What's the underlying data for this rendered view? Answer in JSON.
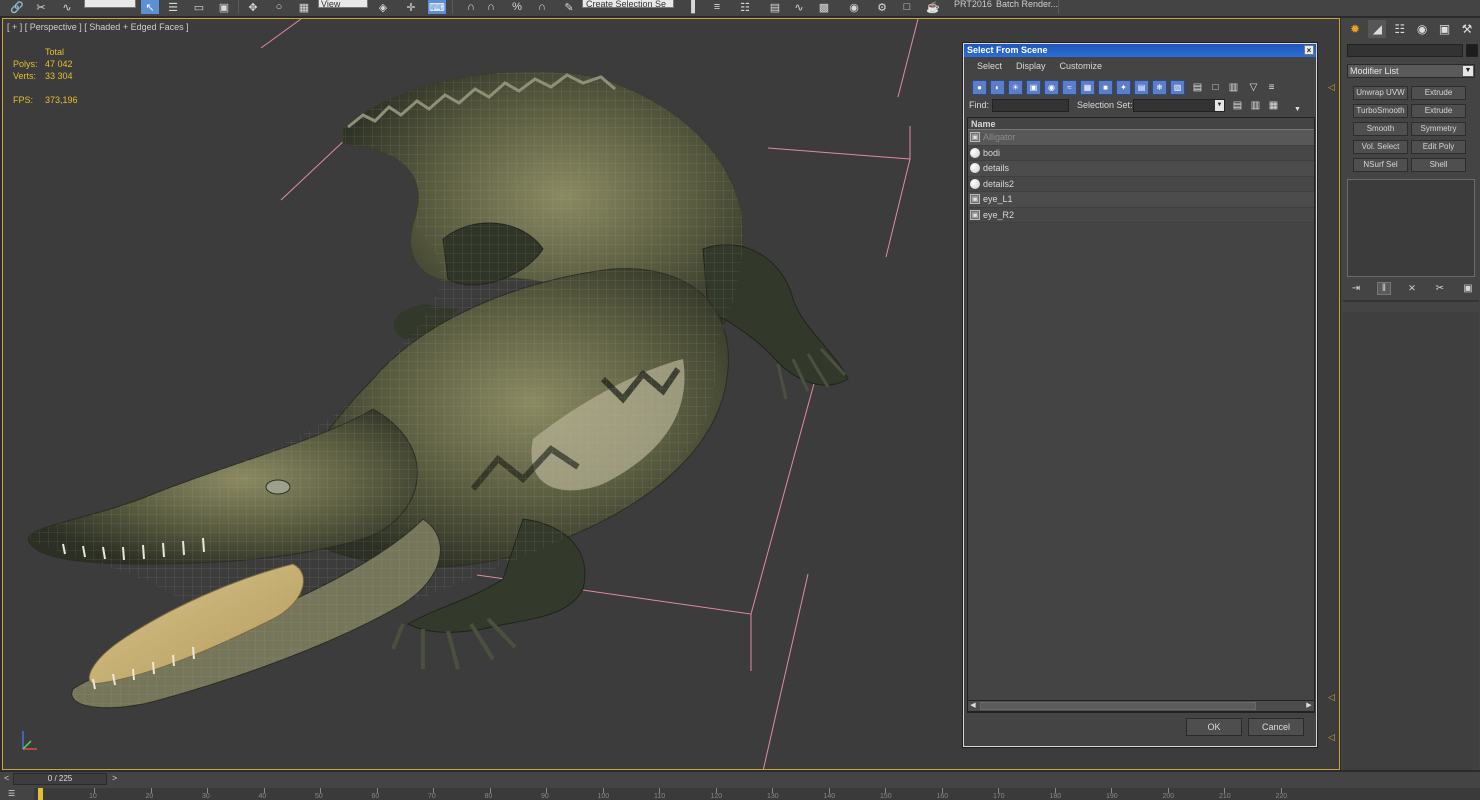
{
  "toolbar": {
    "view_dropdown": "View",
    "selection_set": "Create Selection Se",
    "prt_label": "PRT2016",
    "batch_render": "Batch Render..."
  },
  "viewport": {
    "label": "[ + ] [ Perspective ] [ Shaded + Edged Faces ]",
    "stats": {
      "total_label": "Total",
      "polys_label": "Polys:",
      "polys_value": "47 042",
      "verts_label": "Verts:",
      "verts_value": "33 304",
      "fps_label": "FPS:",
      "fps_value": "373,196"
    }
  },
  "dialog": {
    "title": "Select From Scene",
    "close": "×",
    "menu": [
      "Select",
      "Display",
      "Customize"
    ],
    "find_label": "Find:",
    "find_value": "",
    "selection_set_label": "Selection Set:",
    "column_header": "Name",
    "rows": [
      {
        "name": "Alligator",
        "icon": "group-icon",
        "selected": true
      },
      {
        "name": "bodi",
        "icon": "sphere-icon",
        "selected": false
      },
      {
        "name": "details",
        "icon": "sphere-icon",
        "selected": false
      },
      {
        "name": "details2",
        "icon": "sphere-icon",
        "selected": false
      },
      {
        "name": "eye_L1",
        "icon": "group-icon",
        "selected": false
      },
      {
        "name": "eye_R2",
        "icon": "group-icon",
        "selected": false
      }
    ],
    "ok": "OK",
    "cancel": "Cancel"
  },
  "command_panel": {
    "modifier_list": "Modifier List",
    "modifiers": [
      "Unwrap UVW",
      "Extrude",
      "TurboSmooth",
      "Extrude",
      "Smooth",
      "Symmetry",
      "Vol. Select",
      "Edit Poly",
      "NSurf Sel",
      "Shell"
    ]
  },
  "timeline": {
    "frame": "0 / 225",
    "prev": "<",
    "next": ">",
    "ticks": [
      "10",
      "20",
      "30",
      "40",
      "50",
      "60",
      "70",
      "80",
      "90",
      "100",
      "110",
      "120",
      "130",
      "140",
      "150",
      "160",
      "170",
      "180",
      "190",
      "200",
      "210",
      "220"
    ]
  },
  "colors": {
    "accent": "#2d6fd6",
    "viewport_border": "#c9a53a",
    "stats_text": "#e3c02e",
    "bounding_box": "#e08aa8"
  }
}
